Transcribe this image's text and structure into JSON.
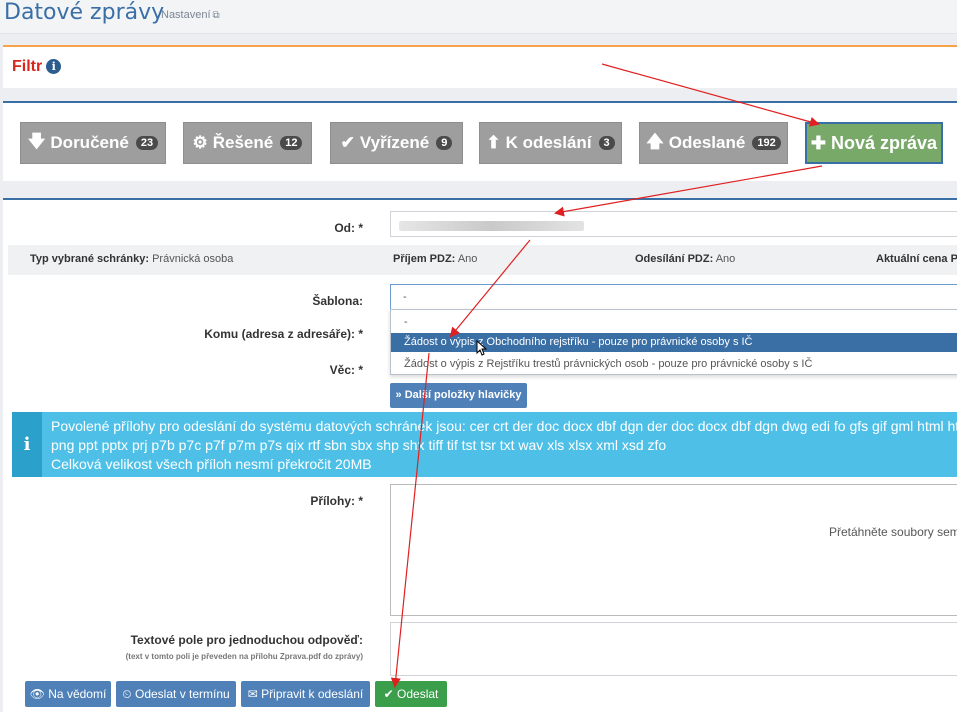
{
  "header": {
    "app_title": "Datové zprávy",
    "settings_link": "Nastavení"
  },
  "filter": {
    "title": "Filtr",
    "info_glyph": "i"
  },
  "folders": [
    {
      "label": "Doručené",
      "count": "23",
      "icon": "arrow-down-icon",
      "glyph": "🡇"
    },
    {
      "label": "Řešené",
      "count": "12",
      "icon": "gears-icon",
      "glyph": "⚙"
    },
    {
      "label": "Vyřízené",
      "count": "9",
      "icon": "check-icon",
      "glyph": "✔"
    },
    {
      "label": "K odeslání",
      "count": "3",
      "icon": "circle-arrow-up-icon",
      "glyph": "⬆"
    },
    {
      "label": "Odeslané",
      "count": "192",
      "icon": "arrow-up-icon",
      "glyph": "🡅"
    }
  ],
  "new_message": {
    "label": "Nová zpráva",
    "glyph": "✚"
  },
  "form": {
    "from_label": "Od: *",
    "mailbox_type_label": "Typ vybrané schránky:",
    "mailbox_type_value": "Právnická osoba",
    "receive_pdz_label": "Příjem PDZ:",
    "receive_pdz_value": "Ano",
    "send_pdz_label": "Odesílání PDZ:",
    "send_pdz_value": "Ano",
    "current_price_label": "Aktuální cena P",
    "template_label": "Šablona:",
    "template_value": "-",
    "template_options": [
      "-",
      "Žádost o výpis z Obchodního rejstříku - pouze pro právnické osoby s IČ",
      "Žádost o výpis z Rejstříku trestů právnických osob - pouze pro právnické osoby s IČ"
    ],
    "to_label": "Komu (adresa z adresáře): *",
    "subject_label": "Věc: *",
    "more_header_items": "Další položky hlavičky",
    "more_glyph": "»",
    "attachments_label": "Přílohy: *",
    "dropzone_text": "Přetáhněte soubory sem a",
    "text_field_label": "Textové pole pro jednoduchou odpověď:",
    "text_field_note": "(text v tomto poli je převeden na přílohu Zprava.pdf do zprávy)"
  },
  "alert": {
    "glyph": "i",
    "line1": "Povolené přílohy pro odeslání do systému datových schránek jsou: cer crt der doc docx dbf dgn der doc docx dbf dgn dwg edi fo gfs gif gml html htm isd",
    "line2": "png ppt pptx prj p7b p7c p7f p7m p7s qix rtf sbn sbx shp shx tiff tif tst tsr txt wav xls xlsx xml xsd zfo",
    "line3": "Celková velikost všech příloh nesmí překročit 20MB"
  },
  "actions": [
    {
      "label": "Na vědomí",
      "icon": "eye-icon",
      "glyph": "👁"
    },
    {
      "label": "Odeslat v termínu",
      "icon": "clock-icon",
      "glyph": "⏲"
    },
    {
      "label": "Připravit k odeslání",
      "icon": "envelope-icon",
      "glyph": "✉"
    },
    {
      "label": "Odeslat",
      "icon": "check-icon",
      "glyph": "✔"
    }
  ],
  "colors": {
    "accent_blue": "#3a6fa6",
    "filter_red": "#d9251c",
    "filter_border": "#f5a24a",
    "folder_gray": "#9e9e9e",
    "new_green": "#79a969",
    "alert_cyan": "#4ec0e8",
    "send_green": "#3a9e4a",
    "arrow_red": "#e02020"
  }
}
